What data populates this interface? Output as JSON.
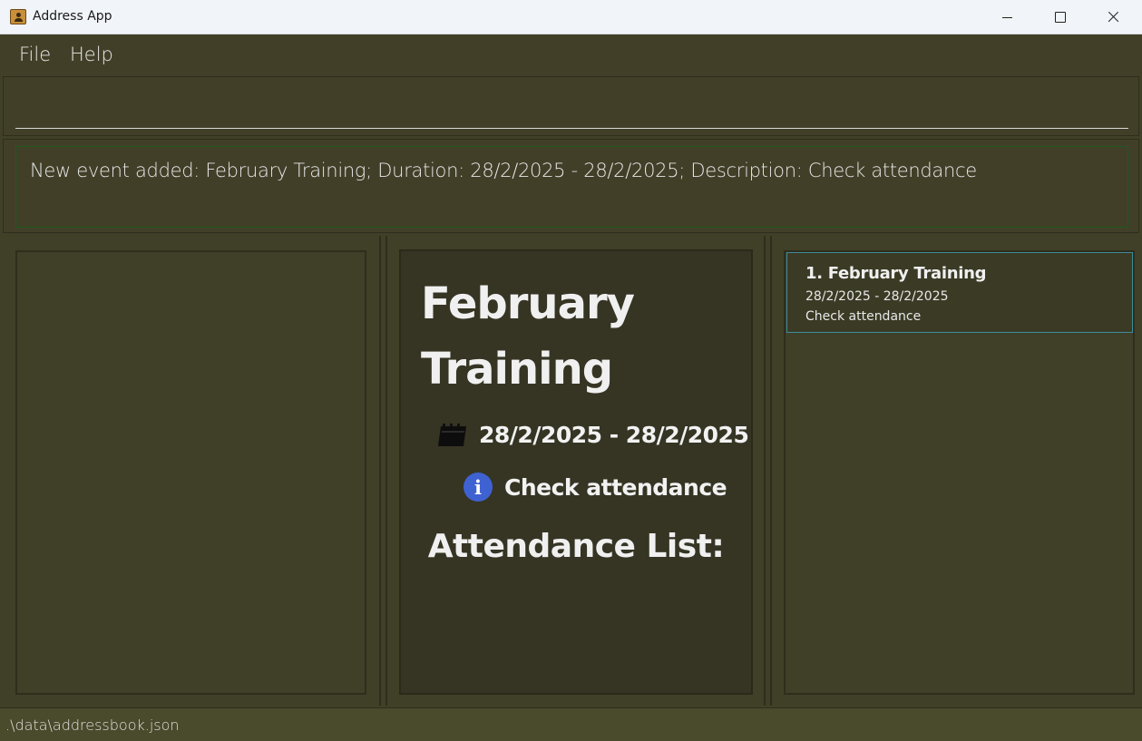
{
  "window": {
    "title": "Address App",
    "icons": {
      "app": "address-book-icon",
      "minimize": "minimize-icon",
      "maximize": "maximize-icon",
      "close": "close-icon"
    }
  },
  "menu": {
    "file_label": "File",
    "help_label": "Help"
  },
  "command_box": {
    "value": "",
    "placeholder": ""
  },
  "result_display": {
    "message": "New event added: February Training; Duration: 28/2/2025 - 28/2/2025; Description: Check attendance"
  },
  "event_detail": {
    "title": "February Training",
    "duration": "28/2/2025 - 28/2/2025",
    "description": "Check attendance",
    "attendance_heading": "Attendance List:",
    "icons": {
      "duration": "calendar-icon",
      "description": "info-icon"
    }
  },
  "event_list": {
    "items": [
      {
        "title": "1. February Training",
        "duration": "28/2/2025 - 28/2/2025",
        "description": "Check attendance"
      }
    ]
  },
  "status_bar": {
    "file_path": ".\\data\\addressbook.json"
  },
  "colors": {
    "background": "#403f28",
    "result_border": "#1f5a1f",
    "selected_card_border": "#3c8c9a",
    "info_icon": "#3f62d2"
  }
}
